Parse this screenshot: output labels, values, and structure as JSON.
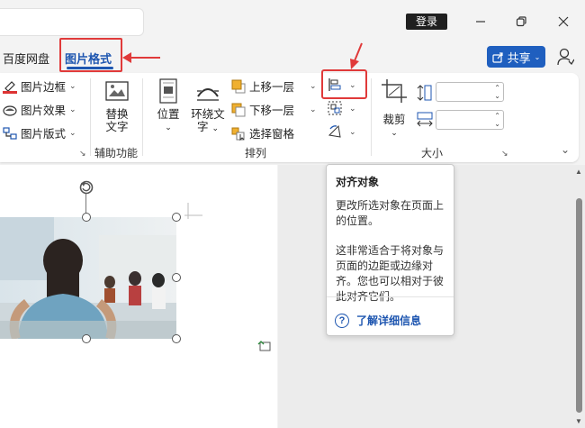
{
  "titlebar": {
    "login_label": "登录",
    "minimize_icon": "minimize-icon",
    "restore_icon": "restore-icon",
    "close_icon": "close-icon"
  },
  "tabs": {
    "baidu_label": "百度网盘",
    "active_label": "图片格式"
  },
  "share": {
    "label": "共享"
  },
  "ribbon": {
    "picture_border": "图片边框",
    "picture_effects": "图片效果",
    "picture_layout": "图片版式",
    "alt_text_line1": "替换",
    "alt_text_line2": "文字",
    "accessibility_group": "辅助功能",
    "position_label": "位置",
    "wrap_text_line1": "环绕文",
    "wrap_text_line2": "字",
    "bring_forward": "上移一层",
    "send_backward": "下移一层",
    "selection_pane": "选择窗格",
    "arrange_group": "排列",
    "crop_label": "裁剪",
    "size_group": "大小"
  },
  "tooltip": {
    "title": "对齐对象",
    "text1": "更改所选对象在页面上的位置。",
    "text2": "这非常适合于将对象与页面的边距或边缘对齐。您也可以相对于彼此对齐它们。",
    "link": "了解详细信息"
  },
  "colors": {
    "accent": "#1e56b0",
    "highlight": "#e03a3a",
    "share_bg": "#1f5fbf"
  }
}
